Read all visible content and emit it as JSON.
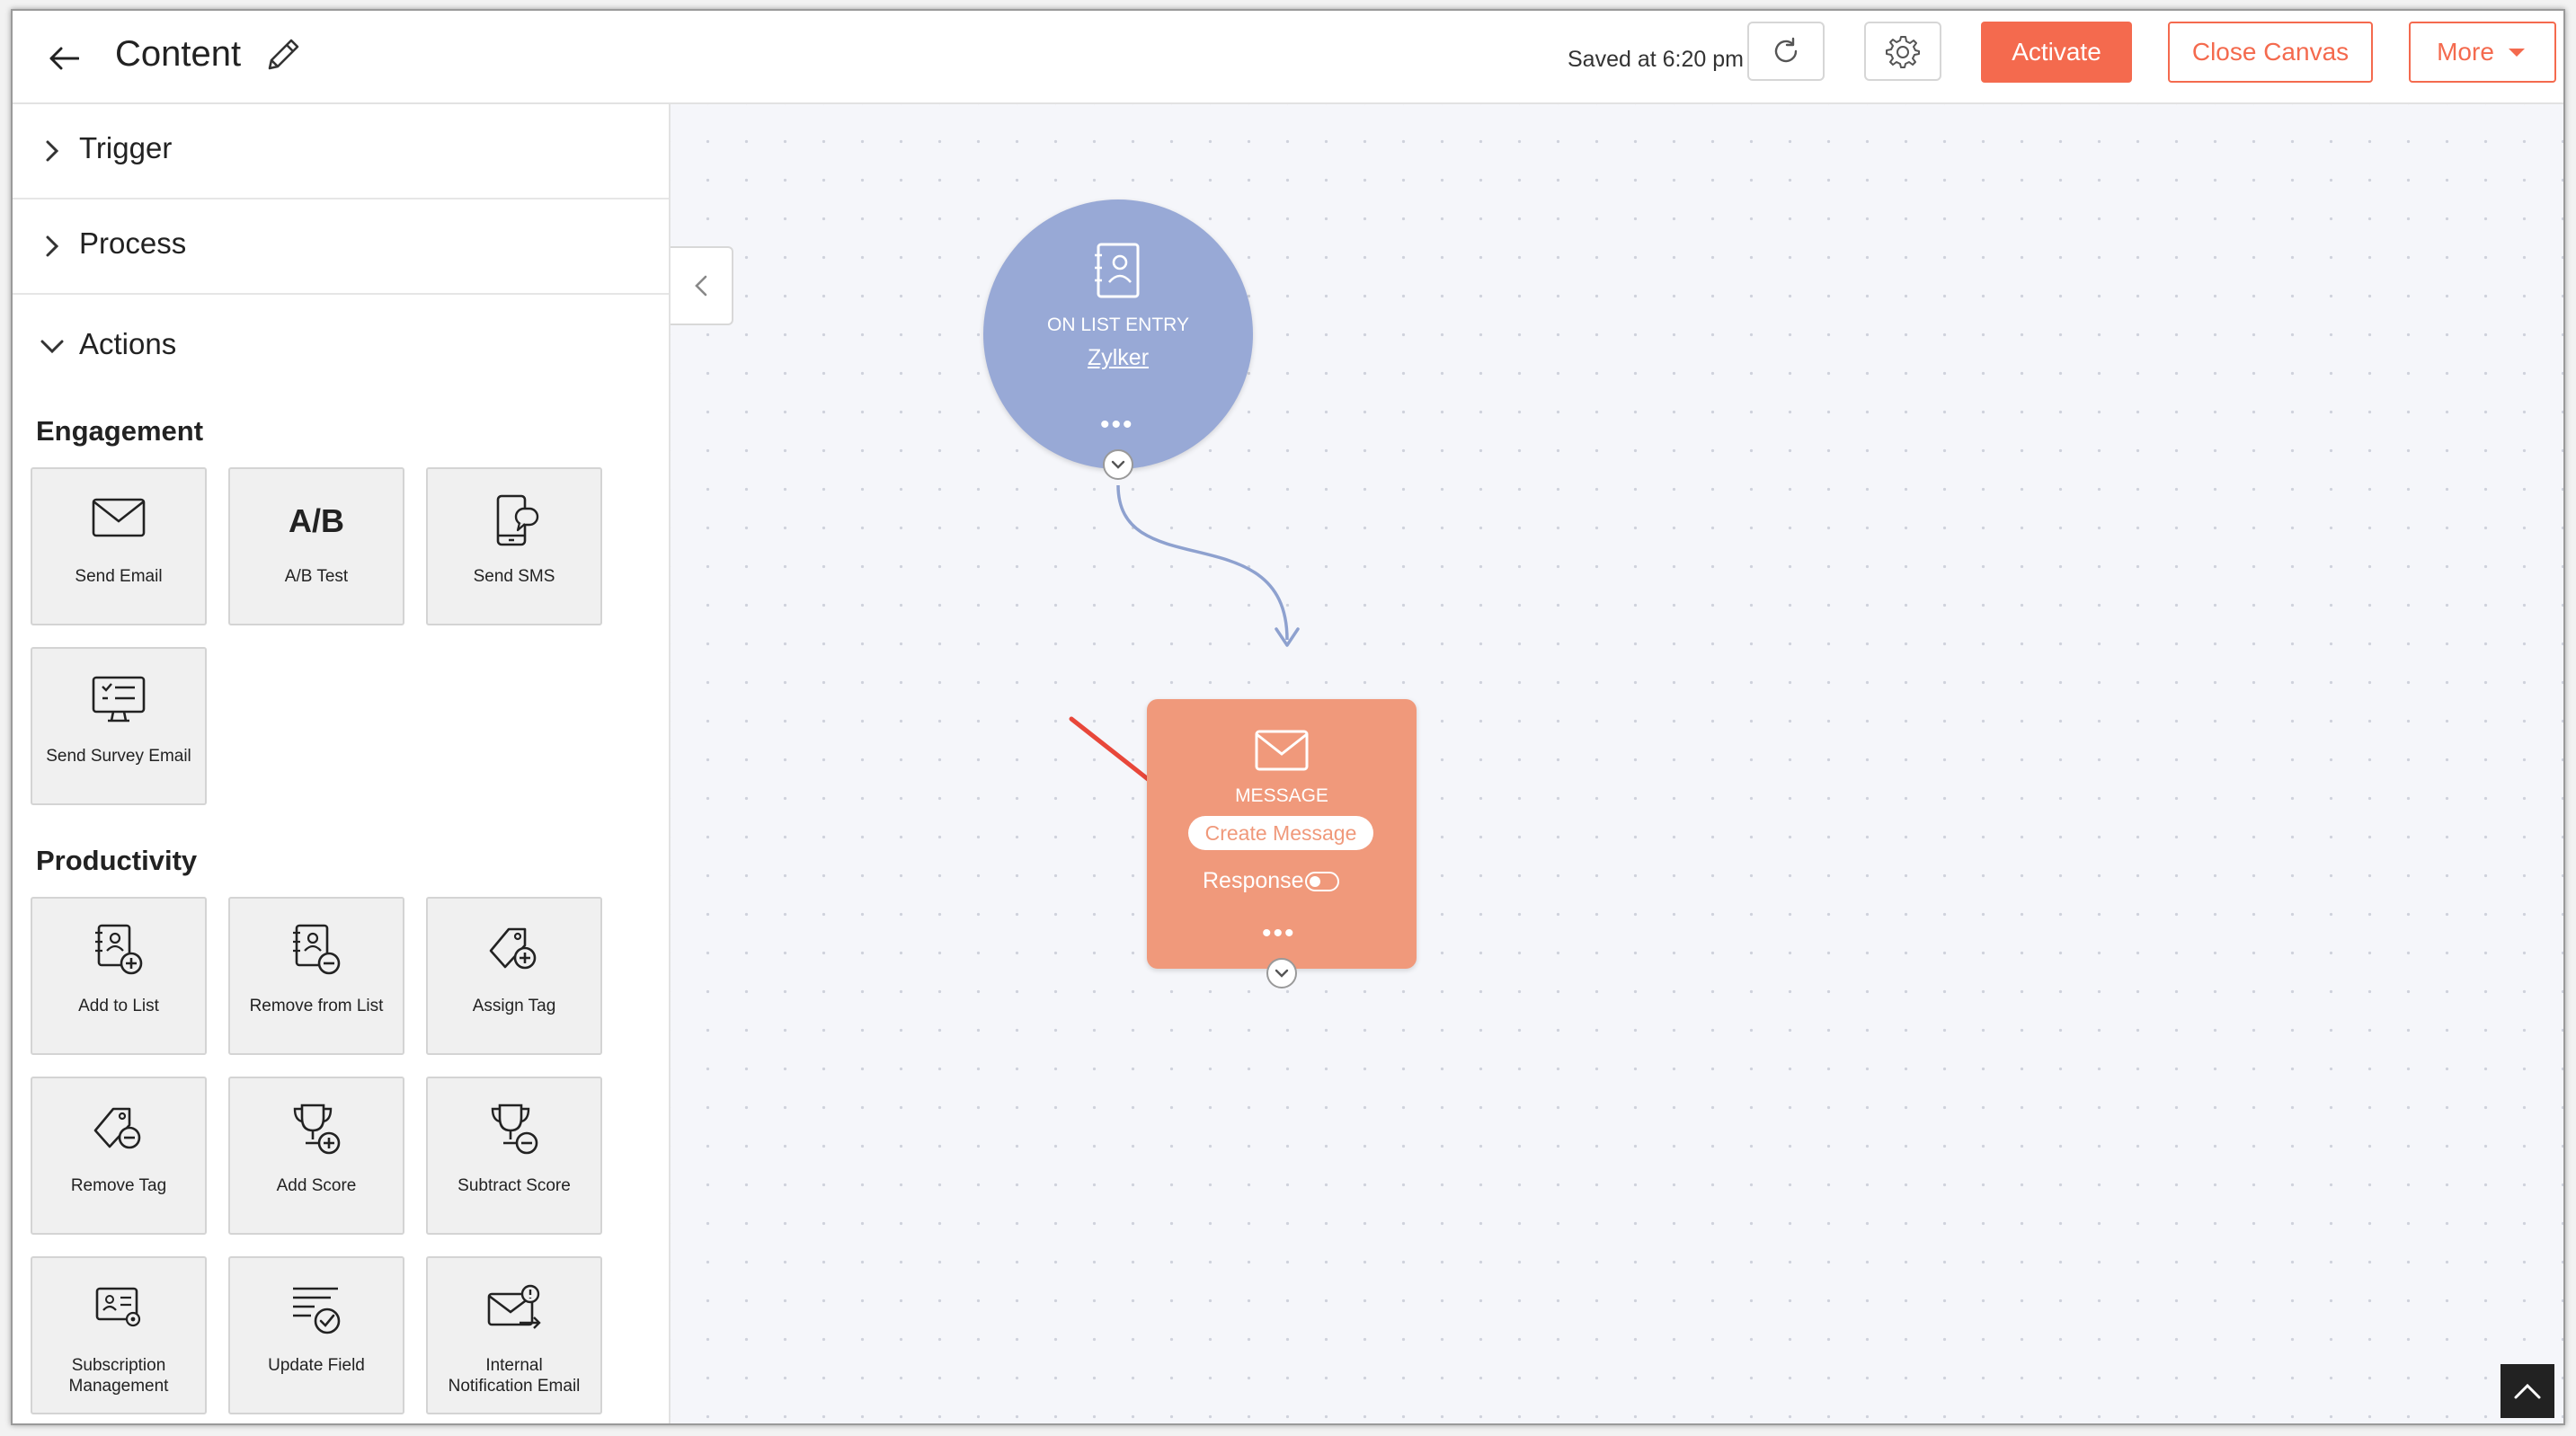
{
  "header": {
    "title": "Content",
    "saved_text": "Saved at 6:20 pm",
    "activate_label": "Activate",
    "close_canvas_label": "Close Canvas",
    "more_label": "More"
  },
  "sidebar": {
    "accordions": [
      {
        "label": "Trigger",
        "expanded": false
      },
      {
        "label": "Process",
        "expanded": false
      },
      {
        "label": "Actions",
        "expanded": true
      }
    ],
    "engagement": {
      "heading": "Engagement",
      "tiles": [
        {
          "label": "Send Email",
          "icon": "envelope-icon"
        },
        {
          "label": "A/B Test",
          "icon": "ab-test-icon",
          "icon_text": "A/B"
        },
        {
          "label": "Send SMS",
          "icon": "phone-chat-icon"
        },
        {
          "label": "Send Survey Email",
          "icon": "monitor-survey-icon"
        }
      ]
    },
    "productivity": {
      "heading": "Productivity",
      "tiles": [
        {
          "label": "Add to List",
          "icon": "list-add-icon"
        },
        {
          "label": "Remove from List",
          "icon": "list-remove-icon"
        },
        {
          "label": "Assign Tag",
          "icon": "tag-add-icon"
        },
        {
          "label": "Remove Tag",
          "icon": "tag-remove-icon"
        },
        {
          "label": "Add Score",
          "icon": "trophy-add-icon"
        },
        {
          "label": "Subtract Score",
          "icon": "trophy-remove-icon"
        },
        {
          "label_lines": [
            "Subscription",
            "Management"
          ],
          "icon": "subscription-icon"
        },
        {
          "label": "Update Field",
          "icon": "update-field-icon"
        },
        {
          "label_lines": [
            "Internal",
            "Notification Email"
          ],
          "icon": "notification-email-icon"
        }
      ]
    }
  },
  "canvas": {
    "trigger_node": {
      "label": "ON LIST ENTRY",
      "link": "Zylker",
      "color": "#98a9d6"
    },
    "message_node": {
      "label": "MESSAGE",
      "create_label": "Create Message",
      "response_label": "Response",
      "response_enabled": false,
      "color": "#f0997b"
    }
  },
  "colors": {
    "accent": "#f46a4e",
    "connector": "#8ea1cf",
    "annotation_arrow": "#e8473a"
  }
}
